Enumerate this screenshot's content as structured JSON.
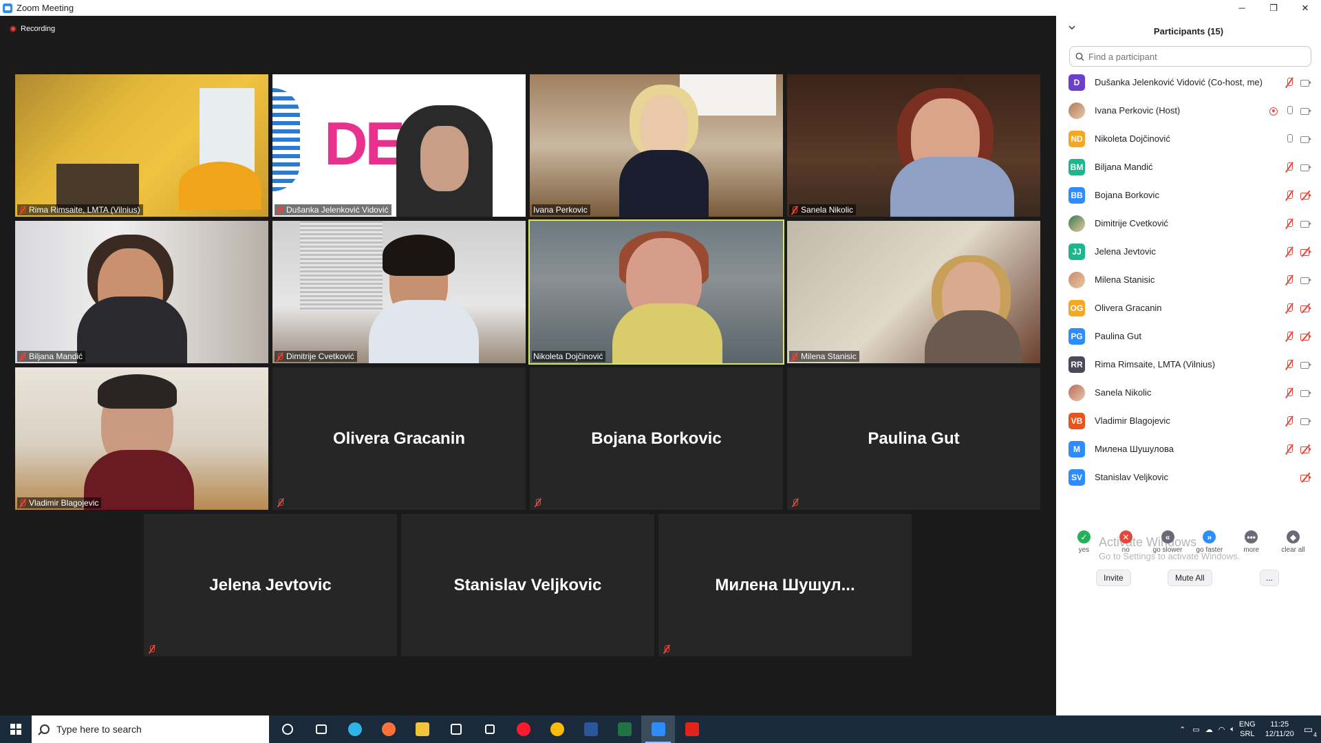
{
  "window": {
    "title": "Zoom Meeting",
    "minimize": "─",
    "maximize": "❐",
    "close": "✕"
  },
  "meeting": {
    "recording_label": "Recording",
    "active_speaker": "Nikoleta Dojčinović",
    "video_tiles": [
      {
        "name": "Rima Rimsaite, LMTA (Vilnius)",
        "muted": true,
        "video_on": true
      },
      {
        "name": "Dušanka Jelenković Vidović",
        "muted": true,
        "video_on": true,
        "background_text": "DE"
      },
      {
        "name": "Ivana Perkovic",
        "muted": false,
        "video_on": true
      },
      {
        "name": "Sanela Nikolic",
        "muted": true,
        "video_on": true
      },
      {
        "name": "Biljana Mandić",
        "muted": true,
        "video_on": true
      },
      {
        "name": "Dimitrije Cvetković",
        "muted": true,
        "video_on": true
      },
      {
        "name": "Nikoleta Dojčinović",
        "muted": false,
        "video_on": true,
        "active": true
      },
      {
        "name": "Milena Stanisic",
        "muted": true,
        "video_on": true
      },
      {
        "name": "Vladimir Blagojevic",
        "muted": true,
        "video_on": true
      }
    ],
    "name_tiles": [
      {
        "name": "Olivera Gracanin",
        "muted": true
      },
      {
        "name": "Bojana Borkovic",
        "muted": true
      },
      {
        "name": "Paulina Gut",
        "muted": true
      },
      {
        "name": "Jelena Jevtovic",
        "muted": true
      },
      {
        "name": "Stanislav Veljkovic",
        "muted": false
      },
      {
        "name": "Милена  Шушул...",
        "muted": true
      }
    ]
  },
  "participants_panel": {
    "title": "Participants (15)",
    "search_placeholder": "Find a participant",
    "participants": [
      {
        "initials": "D",
        "name": "Dušanka Jelenković Vidović (Co-host, me)",
        "color": "#6a3fc9",
        "photo": false,
        "mic": "muted",
        "cam": "on",
        "recording": false
      },
      {
        "initials": "",
        "name": "Ivana Perkovic (Host)",
        "color": "#b07a5a",
        "photo": true,
        "mic": "on",
        "cam": "on",
        "recording": true
      },
      {
        "initials": "ND",
        "name": "Nikoleta Dojčinović",
        "color": "#f5a623",
        "photo": false,
        "mic": "on",
        "cam": "on",
        "recording": false
      },
      {
        "initials": "BM",
        "name": "Biljana Mandić",
        "color": "#1fb58f",
        "photo": false,
        "mic": "muted",
        "cam": "on",
        "recording": false
      },
      {
        "initials": "BB",
        "name": "Bojana Borkovic",
        "color": "#2d8cff",
        "photo": false,
        "mic": "muted",
        "cam": "off",
        "recording": false
      },
      {
        "initials": "",
        "name": "Dimitrije Cvetković",
        "color": "#3a7a4a",
        "photo": true,
        "mic": "muted",
        "cam": "on",
        "recording": false
      },
      {
        "initials": "JJ",
        "name": "Jelena Jevtovic",
        "color": "#1fb58f",
        "photo": false,
        "mic": "muted",
        "cam": "off",
        "recording": false
      },
      {
        "initials": "",
        "name": "Milena Stanisic",
        "color": "#c98a6a",
        "photo": true,
        "mic": "muted",
        "cam": "on",
        "recording": false
      },
      {
        "initials": "OG",
        "name": "Olivera Gracanin",
        "color": "#f5a623",
        "photo": false,
        "mic": "muted",
        "cam": "off",
        "recording": false
      },
      {
        "initials": "PG",
        "name": "Paulina Gut",
        "color": "#2d8cff",
        "photo": false,
        "mic": "muted",
        "cam": "off",
        "recording": false
      },
      {
        "initials": "RR",
        "name": "Rima Rimsaite, LMTA (Vilnius)",
        "color": "#4a4a5a",
        "photo": false,
        "mic": "muted",
        "cam": "on",
        "recording": false
      },
      {
        "initials": "",
        "name": "Sanela Nikolic",
        "color": "#b86a5a",
        "photo": true,
        "mic": "muted",
        "cam": "on",
        "recording": false
      },
      {
        "initials": "VB",
        "name": "Vladimir Blagojevic",
        "color": "#e8541e",
        "photo": false,
        "mic": "muted",
        "cam": "on",
        "recording": false
      },
      {
        "initials": "M",
        "name": "Милена Шушулова",
        "color": "#2d8cff",
        "photo": false,
        "mic": "muted",
        "cam": "off",
        "recording": false
      },
      {
        "initials": "SV",
        "name": "Stanislav Veljkovic",
        "color": "#2d8cff",
        "photo": false,
        "mic": "none",
        "cam": "off",
        "recording": false
      }
    ],
    "reactions": [
      {
        "label": "yes",
        "symbol": "✓",
        "color": "#23b05a"
      },
      {
        "label": "no",
        "symbol": "✕",
        "color": "#e5483b"
      },
      {
        "label": "go slower",
        "symbol": "«",
        "color": "#6a6a76"
      },
      {
        "label": "go faster",
        "symbol": "»",
        "color": "#2d8cff"
      },
      {
        "label": "more",
        "symbol": "•••",
        "color": "#6a6a76"
      },
      {
        "label": "clear all",
        "symbol": "◆",
        "color": "#6a6a76"
      }
    ],
    "watermark_title": "Activate Windows",
    "watermark_sub": "Go to Settings to activate Windows.",
    "invite_label": "Invite",
    "mute_all_label": "Mute All",
    "more_label": "..."
  },
  "taskbar": {
    "search_placeholder": "Type here to search",
    "apps": [
      {
        "name": "cortana-icon",
        "color": "#ffffff"
      },
      {
        "name": "task-view-icon",
        "color": "#ffffff"
      },
      {
        "name": "edge-icon",
        "color": "#2fb4e9"
      },
      {
        "name": "firefox-icon",
        "color": "#ff7139"
      },
      {
        "name": "file-explorer-icon",
        "color": "#f3c33c"
      },
      {
        "name": "store-icon",
        "color": "#ffffff"
      },
      {
        "name": "tablet-icon",
        "color": "#ffffff"
      },
      {
        "name": "opera-icon",
        "color": "#ff1b2d"
      },
      {
        "name": "chrome-icon",
        "color": "#fbbc05"
      },
      {
        "name": "word-icon",
        "color": "#2b579a"
      },
      {
        "name": "excel-icon",
        "color": "#217346"
      },
      {
        "name": "zoom-icon",
        "color": "#2d8cff",
        "active": true
      },
      {
        "name": "acrobat-icon",
        "color": "#e2231a"
      }
    ],
    "lang_top": "ENG",
    "lang_bottom": "SRL",
    "time": "11:25",
    "date": "12/11/20",
    "notifications": "4"
  }
}
